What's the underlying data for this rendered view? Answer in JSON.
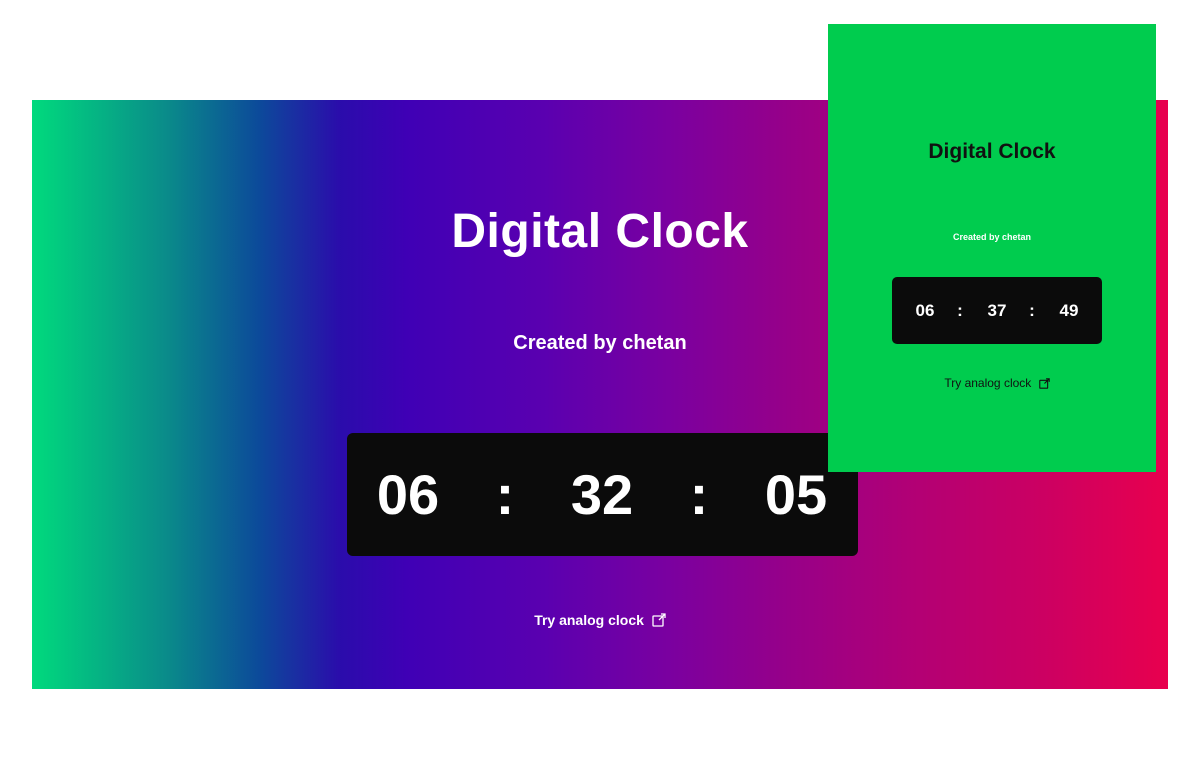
{
  "desktop": {
    "title": "Digital Clock",
    "subtitle": "Created by chetan",
    "clock": {
      "hours": "06",
      "minutes": "32",
      "seconds": "05",
      "separator": ":"
    },
    "link_label": "Try analog clock",
    "link_icon": "external-link-icon"
  },
  "mobile": {
    "title": "Digital Clock",
    "subtitle": "Created by chetan",
    "clock": {
      "hours": "06",
      "minutes": "37",
      "seconds": "49",
      "separator": ":"
    },
    "link_label": "Try analog clock",
    "link_icon": "external-link-icon"
  },
  "colors": {
    "gradient_start": "#00da7d",
    "gradient_mid": "#3f00b5",
    "gradient_end": "#e8004e",
    "mobile_bg": "#00cc4e",
    "clock_bg": "#0b0b0b"
  }
}
